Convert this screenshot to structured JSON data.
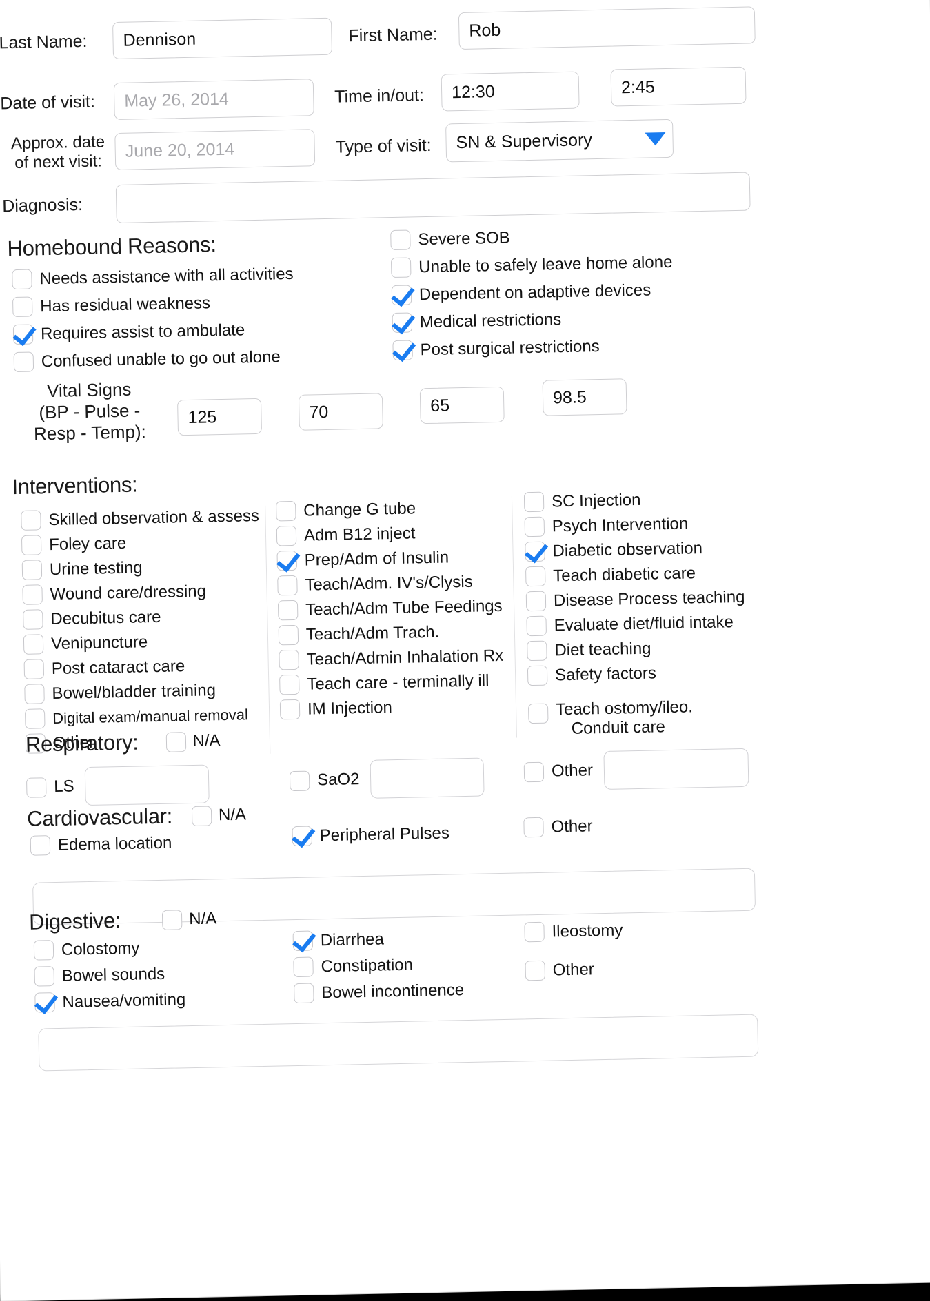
{
  "patient": {
    "last_name_label": "Last Name:",
    "last_name_value": "Dennison",
    "first_name_label": "First Name:",
    "first_name_value": "Rob"
  },
  "visit": {
    "date_label": "Date of visit:",
    "date_placeholder": "May 26, 2014",
    "time_label": "Time in/out:",
    "time_in": "12:30",
    "time_out": "2:45",
    "next_visit_label": "Approx. date of next visit:",
    "next_visit_line1": "Approx. date",
    "next_visit_line2": "of next visit:",
    "next_visit_placeholder": "June 20, 2014",
    "type_label": "Type of visit:",
    "type_value": "SN & Supervisory",
    "diagnosis_label": "Diagnosis:",
    "diagnosis_value": ""
  },
  "homebound": {
    "title": "Homebound Reasons:",
    "left": [
      {
        "label": "Needs assistance with all activities",
        "checked": false
      },
      {
        "label": "Has residual weakness",
        "checked": false
      },
      {
        "label": "Requires assist to ambulate",
        "checked": true
      },
      {
        "label": "Confused unable to go out alone",
        "checked": false
      }
    ],
    "right": [
      {
        "label": "Severe SOB",
        "checked": false
      },
      {
        "label": "Unable to safely leave home alone",
        "checked": false
      },
      {
        "label": "Dependent on adaptive devices",
        "checked": true
      },
      {
        "label": "Medical restrictions",
        "checked": true
      },
      {
        "label": "Post surgical restrictions",
        "checked": true
      }
    ]
  },
  "vitals": {
    "label_line1": "Vital Signs",
    "label_line2": "(BP - Pulse -",
    "label_line3": "Resp - Temp):",
    "bp_systolic": "125",
    "bp_diastolic": "70",
    "pulse": "65",
    "temp": "98.5"
  },
  "interventions": {
    "title": "Interventions:",
    "col1": [
      {
        "label": "Skilled observation & assess",
        "checked": false
      },
      {
        "label": "Foley care",
        "checked": false
      },
      {
        "label": "Urine testing",
        "checked": false
      },
      {
        "label": "Wound care/dressing",
        "checked": false
      },
      {
        "label": "Decubitus care",
        "checked": false
      },
      {
        "label": "Venipuncture",
        "checked": false
      },
      {
        "label": "Post cataract care",
        "checked": false
      },
      {
        "label": "Bowel/bladder training",
        "checked": false
      },
      {
        "label": "Digital exam/manual removal",
        "checked": false
      },
      {
        "label": "Other",
        "checked": false
      }
    ],
    "col2": [
      {
        "label": "Change G tube",
        "checked": false
      },
      {
        "label": "Adm B12 inject",
        "checked": false
      },
      {
        "label": "Prep/Adm of Insulin",
        "checked": true
      },
      {
        "label": "Teach/Adm. IV's/Clysis",
        "checked": false
      },
      {
        "label": "Teach/Adm Tube Feedings",
        "checked": false
      },
      {
        "label": "Teach/Adm Trach.",
        "checked": false
      },
      {
        "label": "Teach/Admin Inhalation Rx",
        "checked": false
      },
      {
        "label": "Teach care - terminally ill",
        "checked": false
      },
      {
        "label": "IM Injection",
        "checked": false
      }
    ],
    "col3": [
      {
        "label": "SC Injection",
        "checked": false
      },
      {
        "label": "Psych Intervention",
        "checked": false
      },
      {
        "label": "Diabetic observation",
        "checked": true
      },
      {
        "label": "Teach diabetic care",
        "checked": false
      },
      {
        "label": "Disease Process teaching",
        "checked": false
      },
      {
        "label": "Evaluate diet/fluid intake",
        "checked": false
      },
      {
        "label": "Diet teaching",
        "checked": false
      },
      {
        "label": "Safety factors",
        "checked": false
      }
    ],
    "ostomy": {
      "line1": "Teach ostomy/ileo.",
      "line2": "Conduit care",
      "checked": false
    }
  },
  "respiratory": {
    "title": "Respiratory:",
    "na_label": "N/A",
    "na_checked": false,
    "ls_label": "LS",
    "ls_checked": false,
    "ls_value": "",
    "sao2_label": "SaO2",
    "sao2_checked": false,
    "sao2_value": "",
    "other_label": "Other",
    "other_checked": false,
    "other_value": ""
  },
  "cardiovascular": {
    "title": "Cardiovascular:",
    "na_label": "N/A",
    "na_checked": false,
    "edema_label": "Edema location",
    "edema_checked": false,
    "pulses_label": "Peripheral Pulses",
    "pulses_checked": true,
    "other_label": "Other",
    "other_checked": false,
    "note_value": ""
  },
  "digestive": {
    "title": "Digestive:",
    "na_label": "N/A",
    "na_checked": false,
    "col1": [
      {
        "label": "Colostomy",
        "checked": false
      },
      {
        "label": "Bowel sounds",
        "checked": false
      },
      {
        "label": "Nausea/vomiting",
        "checked": true
      }
    ],
    "col2": [
      {
        "label": "Diarrhea",
        "checked": true
      },
      {
        "label": "Constipation",
        "checked": false
      },
      {
        "label": "Bowel incontinence",
        "checked": false
      }
    ],
    "col3": [
      {
        "label": "Ileostomy",
        "checked": false
      },
      {
        "label": "Other",
        "checked": false
      }
    ],
    "note_value": ""
  },
  "colors": {
    "accent": "#1a7cf0",
    "field_border": "#cfcfd2",
    "placeholder": "#a9a9ad"
  }
}
